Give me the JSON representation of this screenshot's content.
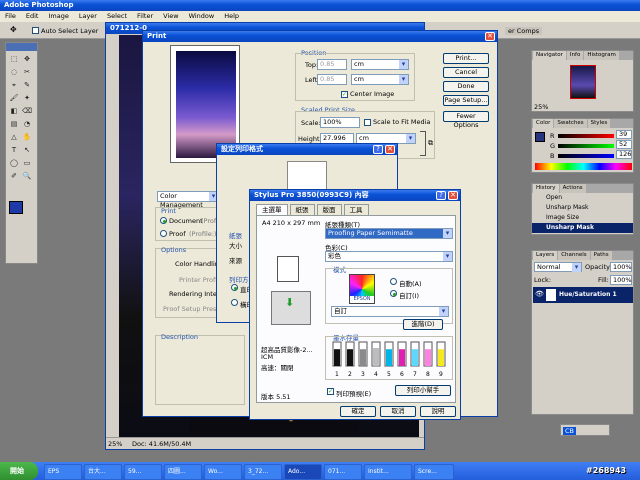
{
  "photoshop": {
    "title": "Adobe Photoshop",
    "menu": [
      "File",
      "Edit",
      "Image",
      "Layer",
      "Select",
      "Filter",
      "View",
      "Window",
      "Help"
    ],
    "options": {
      "auto_select": "Auto Select Layer"
    },
    "toolbar_tabs": "er Comps",
    "doc": {
      "title": "071212-0",
      "zoom": "25%",
      "doc_info": "Doc: 41.6M/50.4M"
    }
  },
  "print": {
    "title": "Print",
    "position": {
      "label": "Position",
      "top_label": "Top:",
      "top_value": "0.85",
      "left_label": "Left:",
      "left_value": "0.85",
      "unit": "cm",
      "center": "Center Image"
    },
    "scaled": {
      "label": "Scaled Print Size",
      "scale_label": "Scale:",
      "scale_value": "100%",
      "fit_media": "Scale to Fit Media",
      "height_label": "Height:",
      "height_value": "27.996",
      "width_label": "Width:",
      "width_value": "18.668",
      "unit": "cm"
    },
    "buttons": {
      "print": "Print...",
      "cancel": "Cancel",
      "done": "Done",
      "page_setup": "Page Setup...",
      "fewer": "Fewer Options"
    },
    "cm": {
      "select": "Color Management",
      "print_label": "Print",
      "document": "Document",
      "document_suffix": "(Profile: sRGB)",
      "proof": "Proof",
      "proof_suffix": "(Profile:)",
      "options": "Options",
      "color_handling": "Color Handling:",
      "printer_profile": "Printer Profile:",
      "rendering": "Rendering Intent:",
      "proof_setup": "Proof Setup Preset:",
      "description": "Description"
    }
  },
  "pagesetup": {
    "title": "設定列印格式",
    "paper_group": "紙張",
    "size_label": "大小",
    "source_label": "來源",
    "orient_group": "列印方向",
    "portrait": "直印",
    "landscape": "橫印"
  },
  "epson": {
    "title": "Stylus Pro 3850(0993C9) 內容",
    "tabs": [
      "主選單",
      "紙張",
      "版面",
      "工具"
    ],
    "paper": "A4 210 x 297 mm",
    "media_label": "紙張種類(T)",
    "media_value": "Proofing Paper Semimatte",
    "color_label": "色彩(C)",
    "color_value": "彩色",
    "mode_label": "模式",
    "auto": "自動(A)",
    "custom": "自訂(I)",
    "custom_value": "自訂",
    "advanced": "進階(D)",
    "quality_lines": [
      "超高品質影像-2...",
      "ICM",
      "高速：關閉"
    ],
    "ink_label": "墨水存量",
    "ink_numbers": [
      "1",
      "2",
      "3",
      "4",
      "5",
      "6",
      "7",
      "8",
      "9"
    ],
    "ink_levels": [
      0.7,
      0.7,
      0.7,
      0.75,
      0.7,
      0.7,
      0.7,
      0.7,
      0.7
    ],
    "ink_colors": [
      "#111111",
      "#111111",
      "#8a8a8a",
      "#bdbdbd",
      "#00b4e6",
      "#e020b0",
      "#5fd8ff",
      "#ff80e0",
      "#f4e820"
    ],
    "preview_label": "列印預視(E)",
    "print_help": "列印小幫手",
    "version": "版本 5.51",
    "ok": "確定",
    "cancel": "取消",
    "help": "說明"
  },
  "panels": {
    "navigator": {
      "tabs": [
        "Navigator",
        "Info",
        "Histogram"
      ],
      "zoom": "25%"
    },
    "color": {
      "tabs": [
        "Color",
        "Swatches",
        "Styles"
      ],
      "r": "R",
      "g": "G",
      "b": "B",
      "r_val": "39",
      "g_val": "52",
      "b_val": "126"
    },
    "history": {
      "tabs": [
        "History",
        "Actions"
      ],
      "items": [
        "Open",
        "Unsharp Mask",
        "Image Size",
        "Unsharp Mask"
      ]
    },
    "layers": {
      "tabs": [
        "Layers",
        "Channels",
        "Paths"
      ],
      "mode": "Normal",
      "opacity_label": "Opacity:",
      "opacity": "100%",
      "lock_label": "Lock:",
      "fill_label": "Fill:",
      "fill": "100%",
      "layer_name": "Hue/Saturation 1"
    }
  },
  "taskbar": {
    "start": "開始",
    "buttons": [
      "EPS",
      "台大...",
      "59...",
      "四圖...",
      "Wo...",
      "3_72...",
      "Ado...",
      "071...",
      "Instit...",
      "Scre..."
    ],
    "watermark": "#268943"
  },
  "colors": {
    "accent": "#0a52d6",
    "taskbar": "#245edb",
    "start": "#3c9a3c"
  }
}
